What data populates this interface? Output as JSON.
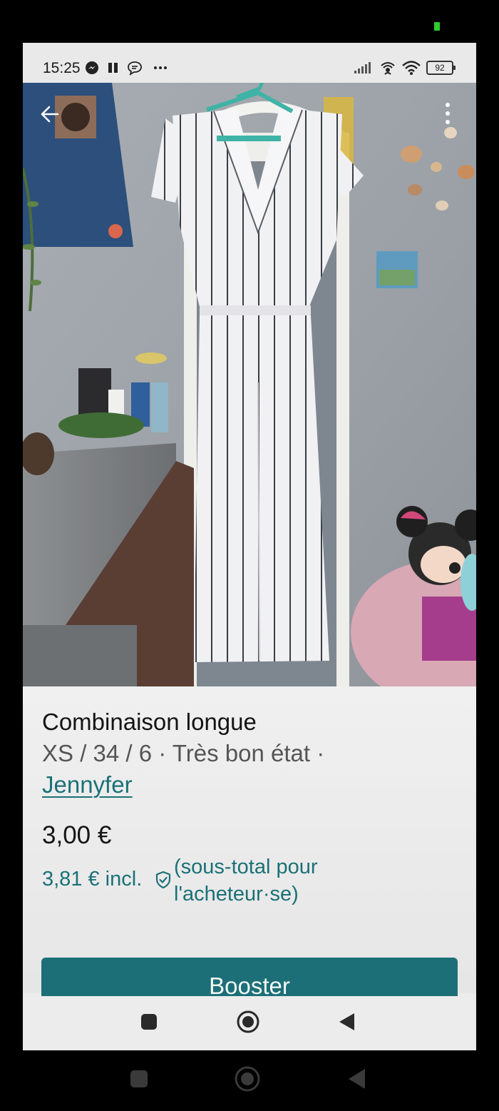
{
  "status_bar": {
    "time": "15:25",
    "battery_level": "92",
    "left_icons": [
      "messenger-icon",
      "pause-icon",
      "chat-bubble-icon",
      "more-dots-icon"
    ],
    "right_icons": [
      "signal-icon",
      "hotspot-icon",
      "wifi-icon",
      "battery-icon"
    ]
  },
  "photo": {
    "back_icon": "arrow-left-icon",
    "menu_icon": "more-vertical-icon"
  },
  "listing": {
    "title": "Combinaison longue",
    "subtitle": "XS / 34 / 6 · Très bon état ·",
    "brand": "Jennyfer",
    "price": "3,00 €",
    "price_incl": "3,81 € incl.",
    "buyer_note": "(sous-total pour l'acheteur·se)",
    "protection_icon": "shield-check-icon"
  },
  "actions": {
    "booster_label": "Booster"
  },
  "colors": {
    "accent": "#1c6f76",
    "link": "#1b7177"
  },
  "nav": {
    "buttons": [
      "recents-square-icon",
      "home-circle-icon",
      "back-triangle-icon"
    ]
  }
}
